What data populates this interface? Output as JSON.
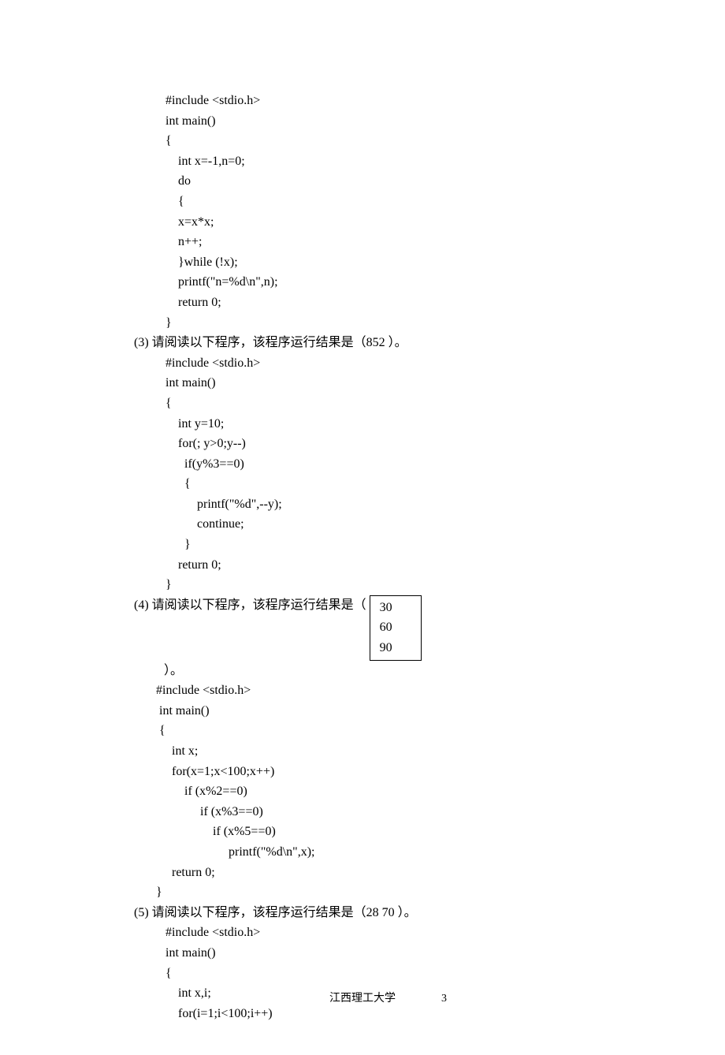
{
  "code1": "#include <stdio.h>\nint main()\n{\n    int x=-1,n=0;\n    do\n    {\n    x=x*x;\n    n++;\n    }while (!x);\n    printf(\"n=%d\\n\",n);\n    return 0;\n}",
  "q3": {
    "num": "(3)",
    "text": "  请阅读以下程序，该程序运行结果是（",
    "answer": "852",
    "tail": "     ）。",
    "code": "#include <stdio.h>\nint main()\n{\n    int y=10;\n    for(; y>0;y--)\n      if(y%3==0)\n      {\n          printf(\"%d\",--y);\n          continue;\n      }\n    return 0;\n}"
  },
  "q4": {
    "num": "(4)",
    "text": "  请阅读以下程序，该程序运行结果是（",
    "tail2": "）。",
    "answer": "30\n60\n90",
    "code": "#include <stdio.h>\n int main()\n {\n     int x;\n     for(x=1;x<100;x++)\n         if (x%2==0)\n              if (x%3==0)\n                  if (x%5==0)\n                       printf(\"%d\\n\",x);\n     return 0;\n}"
  },
  "q5": {
    "num": "(5)",
    "text": "  请阅读以下程序，该程序运行结果是（",
    "answer": "28  70",
    "tail": "     ）。",
    "code": "#include <stdio.h>\nint main()\n{\n    int x,i;\n    for(i=1;i<100;i++)"
  },
  "footer": {
    "org": "江西理工大学",
    "page": "3"
  }
}
